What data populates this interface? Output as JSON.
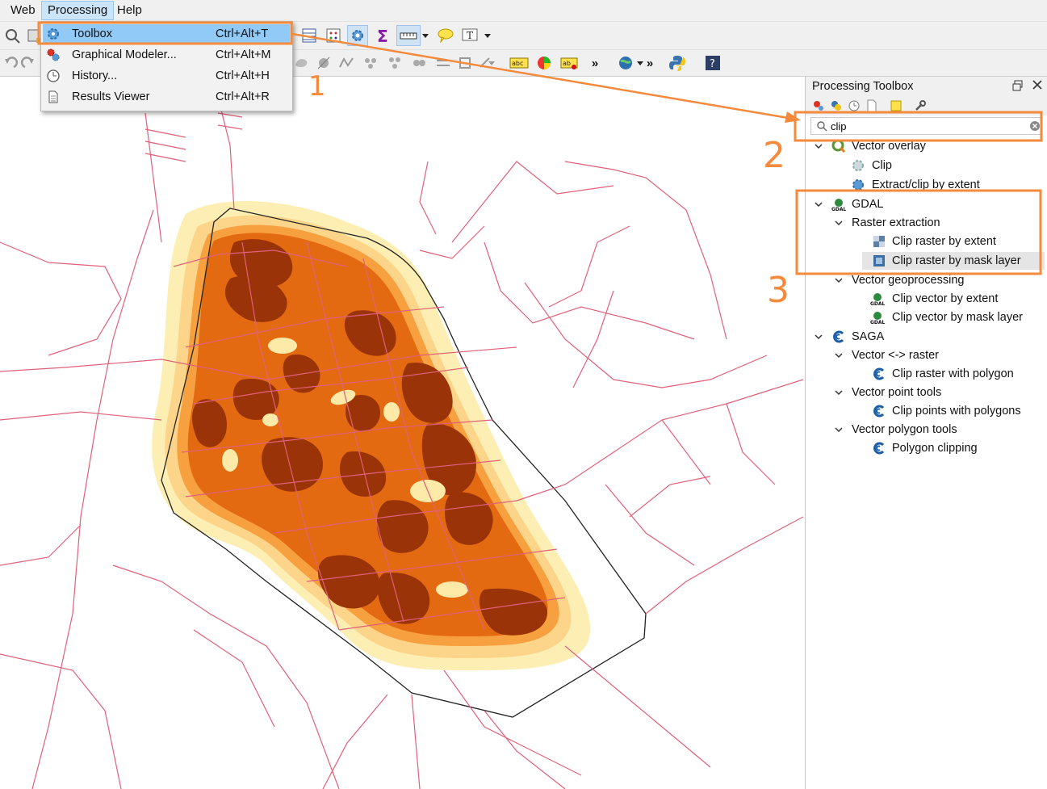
{
  "menubar": {
    "items": [
      {
        "label": "Web"
      },
      {
        "label": "Processing"
      },
      {
        "label": "Help"
      }
    ]
  },
  "processing_menu": {
    "items": [
      {
        "label": "Toolbox",
        "shortcut": "Ctrl+Alt+T",
        "icon": "gear-icon"
      },
      {
        "label": "Graphical Modeler...",
        "shortcut": "Ctrl+Alt+M",
        "icon": "modeler-icon"
      },
      {
        "label": "History...",
        "shortcut": "Ctrl+Alt+H",
        "icon": "clock-icon"
      },
      {
        "label": "Results Viewer",
        "shortcut": "Ctrl+Alt+R",
        "icon": "document-icon"
      }
    ]
  },
  "panel": {
    "title": "Processing Toolbox",
    "search_value": "clip",
    "tree": [
      {
        "label": "Vector overlay",
        "level": 0,
        "expanded": true,
        "icon": "qgis-icon"
      },
      {
        "label": "Clip",
        "level": 1,
        "icon": "gear-icon"
      },
      {
        "label": "Extract/clip by extent",
        "level": 1,
        "icon": "gear-icon"
      },
      {
        "label": "GDAL",
        "level": 0,
        "expanded": true,
        "icon": "gdal-icon"
      },
      {
        "label": "Raster extraction",
        "level": 1,
        "expanded": true
      },
      {
        "label": "Clip raster by extent",
        "level": 2,
        "icon": "raster-icon"
      },
      {
        "label": "Clip raster by mask layer",
        "level": 2,
        "icon": "raster-icon",
        "selected": true
      },
      {
        "label": "Vector geoprocessing",
        "level": 1,
        "expanded": true
      },
      {
        "label": "Clip vector by extent",
        "level": 2,
        "icon": "gdal-icon"
      },
      {
        "label": "Clip vector by mask layer",
        "level": 2,
        "icon": "gdal-icon"
      },
      {
        "label": "SAGA",
        "level": 0,
        "expanded": true,
        "icon": "saga-icon"
      },
      {
        "label": "Vector <-> raster",
        "level": 1,
        "expanded": true
      },
      {
        "label": "Clip raster with polygon",
        "level": 2,
        "icon": "saga-icon"
      },
      {
        "label": "Vector point tools",
        "level": 1,
        "expanded": true
      },
      {
        "label": "Clip points with polygons",
        "level": 2,
        "icon": "saga-icon"
      },
      {
        "label": "Vector polygon tools",
        "level": 1,
        "expanded": true
      },
      {
        "label": "Polygon clipping",
        "level": 2,
        "icon": "saga-icon"
      }
    ]
  },
  "annotations": {
    "step1": "1",
    "step2": "2",
    "step3": "3",
    "color": "#f58a3c"
  },
  "colors": {
    "accent": "#91c9f7",
    "heat_dark": "#9a3408",
    "heat_mid": "#e0600f",
    "heat_light": "#f99d3a",
    "heat_pale": "#fde3a0",
    "roads": "#e0607a"
  }
}
